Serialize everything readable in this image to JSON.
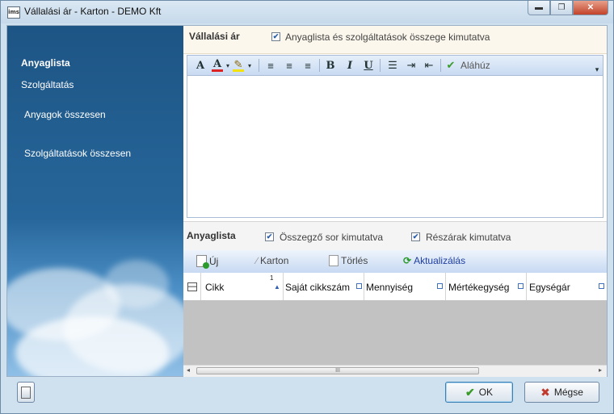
{
  "window": {
    "title": "Vállalási ár - Karton  - DEMO Kft",
    "app_icon_text": "ims",
    "controls": {
      "minimize": "▬",
      "restore": "❐",
      "close": "✕"
    }
  },
  "sidebar": {
    "items": [
      {
        "label": "Anyaglista",
        "active": true
      },
      {
        "label": "Szolgáltatás",
        "active": false
      },
      {
        "label": "Anyagok összesen",
        "active": false
      },
      {
        "label": "Szolgáltatások összesen",
        "active": false
      }
    ]
  },
  "price_section": {
    "title": "Vállalási ár",
    "checkbox_label": "Anyaglista és szolgáltatások összege kimutatva",
    "checked": true
  },
  "editor_toolbar": {
    "font_icon": "A",
    "font_color_icon": "A",
    "highlight_icon": "✎",
    "align_left": "≡",
    "align_center": "≡",
    "align_right": "≡",
    "bold": "B",
    "italic": "I",
    "underline": "U",
    "bullets": "☰",
    "indent": "⇥",
    "outdent": "⇤",
    "signature_label": "Aláhúz",
    "check_icon": "✔",
    "dropdown": "▾",
    "corner": "▾"
  },
  "material_section": {
    "title": "Anyaglista",
    "summary_label": "Összegző sor kimutatva",
    "summary_checked": true,
    "partial_label": "Részárak kimutatva",
    "partial_checked": true
  },
  "grid_toolbar": {
    "new_label": "Új",
    "card_label": "Karton",
    "delete_label": "Törlés",
    "refresh_label": "Aktualizálás"
  },
  "grid": {
    "sort_index": "1",
    "columns": [
      "Cikk",
      "Saját cikkszám",
      "Mennyiség",
      "Mértékegység",
      "Egységár"
    ]
  },
  "scrollbar": {
    "left": "◂",
    "right": "▸",
    "grip": "III"
  },
  "footer": {
    "ok_label": "OK",
    "cancel_label": "Mégse",
    "ok_icon": "✔",
    "cancel_icon": "✖"
  },
  "colors": {
    "accent": "#27669a",
    "ok_green": "#3a9a2a",
    "cancel_red": "#c0392b",
    "font_red": "#d22",
    "highlight_yellow": "#f2e20a"
  }
}
